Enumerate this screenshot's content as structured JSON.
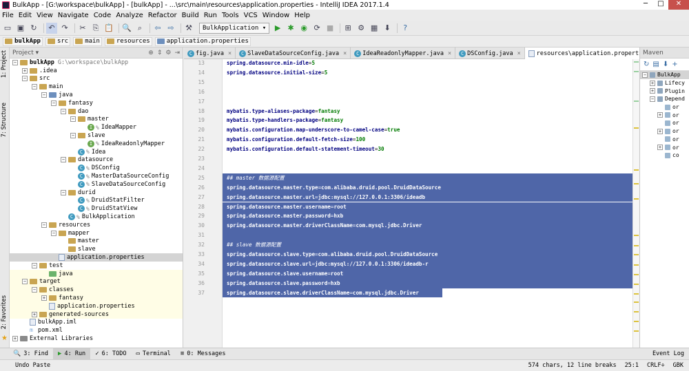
{
  "window": {
    "title": "BulkApp - [G:\\workspace\\bulkApp] - [bulkApp] - ...\\src\\main\\resources\\application.properties - IntelliJ IDEA 2017.1.4"
  },
  "menu": [
    "File",
    "Edit",
    "View",
    "Navigate",
    "Code",
    "Analyze",
    "Refactor",
    "Build",
    "Run",
    "Tools",
    "VCS",
    "Window",
    "Help"
  ],
  "toolbar": {
    "run_config": "BulkApplication ▾"
  },
  "breadcrumbs": [
    "bulkApp",
    "src",
    "main",
    "resources",
    "application.properties"
  ],
  "left_strip": {
    "project": "1: Project",
    "structure": "7: Structure",
    "favorites": "2: Favorites"
  },
  "project_panel": {
    "header": "Project ▾",
    "tree": [
      {
        "d": 0,
        "exp": "−",
        "icon": "folder",
        "label": "bulkApp",
        "path": "G:\\workspace\\bulkApp",
        "bold": true
      },
      {
        "d": 1,
        "exp": "+",
        "icon": "folder",
        "label": ".idea"
      },
      {
        "d": 1,
        "exp": "−",
        "icon": "folder",
        "label": "src"
      },
      {
        "d": 2,
        "exp": "−",
        "icon": "folder",
        "label": "main"
      },
      {
        "d": 3,
        "exp": "−",
        "icon": "folder-blue",
        "label": "java"
      },
      {
        "d": 4,
        "exp": "−",
        "icon": "folder",
        "label": "fantasy"
      },
      {
        "d": 5,
        "exp": "−",
        "icon": "folder",
        "label": "dao"
      },
      {
        "d": 6,
        "exp": "−",
        "icon": "folder",
        "label": "master"
      },
      {
        "d": 7,
        "exp": "",
        "icon": "interface",
        "label": "IdeaMapper"
      },
      {
        "d": 6,
        "exp": "−",
        "icon": "folder",
        "label": "slave"
      },
      {
        "d": 7,
        "exp": "",
        "icon": "interface",
        "label": "IdeaReadonlyMapper"
      },
      {
        "d": 6,
        "exp": "",
        "icon": "class",
        "label": "Idea"
      },
      {
        "d": 5,
        "exp": "−",
        "icon": "folder",
        "label": "datasource"
      },
      {
        "d": 6,
        "exp": "",
        "icon": "class",
        "label": "DSConfig"
      },
      {
        "d": 6,
        "exp": "",
        "icon": "class",
        "label": "MasterDataSourceConfig"
      },
      {
        "d": 6,
        "exp": "",
        "icon": "class",
        "label": "SlaveDataSourceConfig"
      },
      {
        "d": 5,
        "exp": "−",
        "icon": "folder",
        "label": "durid"
      },
      {
        "d": 6,
        "exp": "",
        "icon": "class",
        "label": "DruidStatFilter"
      },
      {
        "d": 6,
        "exp": "",
        "icon": "class",
        "label": "DruidStatView"
      },
      {
        "d": 5,
        "exp": "",
        "icon": "class",
        "label": "BulkApplication"
      },
      {
        "d": 3,
        "exp": "−",
        "icon": "folder",
        "label": "resources"
      },
      {
        "d": 4,
        "exp": "−",
        "icon": "folder",
        "label": "mapper"
      },
      {
        "d": 5,
        "exp": "",
        "icon": "folder",
        "label": "master"
      },
      {
        "d": 5,
        "exp": "",
        "icon": "folder",
        "label": "slave"
      },
      {
        "d": 4,
        "exp": "",
        "icon": "file",
        "label": "application.properties",
        "sel": true
      },
      {
        "d": 2,
        "exp": "−",
        "icon": "folder",
        "label": "test"
      },
      {
        "d": 3,
        "exp": "",
        "icon": "folder-green",
        "label": "java",
        "yel": true
      },
      {
        "d": 1,
        "exp": "−",
        "icon": "folder",
        "label": "target",
        "yel": true
      },
      {
        "d": 2,
        "exp": "−",
        "icon": "folder",
        "label": "classes",
        "yel": true
      },
      {
        "d": 3,
        "exp": "+",
        "icon": "folder",
        "label": "fantasy",
        "yel": true
      },
      {
        "d": 3,
        "exp": "",
        "icon": "file",
        "label": "application.properties",
        "yel": true
      },
      {
        "d": 2,
        "exp": "+",
        "icon": "folder",
        "label": "generated-sources",
        "yel": true
      },
      {
        "d": 1,
        "exp": "",
        "icon": "file",
        "label": "bulkApp.iml"
      },
      {
        "d": 1,
        "exp": "",
        "icon": "maven",
        "label": "pom.xml"
      },
      {
        "d": 0,
        "exp": "+",
        "icon": "lib",
        "label": "External Libraries"
      }
    ]
  },
  "tabs": [
    {
      "label": "fig.java",
      "x": true
    },
    {
      "label": "SlaveDataSourceConfig.java",
      "x": true
    },
    {
      "label": "IdeaReadonlyMapper.java",
      "x": true
    },
    {
      "label": "DSConfig.java",
      "x": true
    },
    {
      "label": "resources\\application.properties",
      "x": true,
      "active": true
    }
  ],
  "editor": {
    "lines": [
      {
        "n": "13",
        "k": "spring.datasource.min-idle",
        "v": "5"
      },
      {
        "n": "14",
        "k": "spring.datasource.initial-size",
        "v": "5"
      },
      {
        "n": "15",
        "k": "",
        "v": ""
      },
      {
        "n": "16",
        "k": "",
        "v": ""
      },
      {
        "n": "17",
        "k": "",
        "v": ""
      },
      {
        "n": "18",
        "k": "mybatis.type-aliases-package",
        "v": "fantasy"
      },
      {
        "n": "19",
        "k": "mybatis.type-handlers-package",
        "v": "fantasy"
      },
      {
        "n": "20",
        "k": "mybatis.configuration.map-underscore-to-camel-case",
        "v": "true"
      },
      {
        "n": "21",
        "k": "mybatis.configuration.default-fetch-size",
        "v": "100"
      },
      {
        "n": "22",
        "k": "mybatis.configuration.default-statement-timeout",
        "v": "30"
      },
      {
        "n": "23",
        "k": "",
        "v": ""
      },
      {
        "n": "24",
        "k": "",
        "v": ""
      },
      {
        "n": "25",
        "c": "## master 数据源配置",
        "sel": true
      },
      {
        "n": "26",
        "k": "spring.datasource.master.type",
        "v": "com.alibaba.druid.pool.DruidDataSource",
        "sel": true
      },
      {
        "n": "27",
        "k": "spring.datasource.master.url",
        "v": "jdbc:mysql://127.0.0.1:3306/ideadb",
        "sel": true
      },
      {
        "n": "28",
        "k": "spring.datasource.master.username",
        "v": "root",
        "sel": true
      },
      {
        "n": "29",
        "k": "spring.datasource.master.password",
        "v": "hxb",
        "sel": true
      },
      {
        "n": "30",
        "k": "spring.datasource.master.driverClassName",
        "v": "com.mysql.jdbc.Driver",
        "sel": true
      },
      {
        "n": "31",
        "k": "",
        "v": "",
        "sel": true
      },
      {
        "n": "32",
        "c": "## slave 数据源配置",
        "sel": true
      },
      {
        "n": "33",
        "k": "spring.datasource.slave.type",
        "v": "com.alibaba.druid.pool.DruidDataSource",
        "sel": true
      },
      {
        "n": "34",
        "k": "spring.datasource.slave.url",
        "v": "jdbc:mysql://127.0.0.1:3306/ideadb-r",
        "sel": true
      },
      {
        "n": "35",
        "k": "spring.datasource.slave.username",
        "v": "root",
        "sel": true
      },
      {
        "n": "36",
        "k": "spring.datasource.slave.password",
        "v": "hxb",
        "sel": true
      },
      {
        "n": "37",
        "k": "spring.datasource.slave.driverClassName",
        "v": "com.mysql.jdbc.Driver",
        "sel": true,
        "partial": true
      }
    ]
  },
  "maven": {
    "header": "Maven",
    "tree": [
      {
        "d": 0,
        "exp": "−",
        "label": "BulkApp",
        "sel": true
      },
      {
        "d": 1,
        "exp": "+",
        "label": "Lifecy"
      },
      {
        "d": 1,
        "exp": "+",
        "label": "Plugin"
      },
      {
        "d": 1,
        "exp": "−",
        "label": "Depend"
      },
      {
        "d": 2,
        "exp": "",
        "label": "or"
      },
      {
        "d": 2,
        "exp": "+",
        "label": "or"
      },
      {
        "d": 2,
        "exp": "",
        "label": "or"
      },
      {
        "d": 2,
        "exp": "+",
        "label": "or"
      },
      {
        "d": 2,
        "exp": "",
        "label": "or"
      },
      {
        "d": 2,
        "exp": "+",
        "label": "or"
      },
      {
        "d": 2,
        "exp": "",
        "label": "co"
      }
    ]
  },
  "bottom_tabs": [
    {
      "icon": "🔍",
      "label": "3: Find"
    },
    {
      "icon": "▶",
      "label": "4: Run",
      "active": true
    },
    {
      "icon": "✓",
      "label": "6: TODO"
    },
    {
      "icon": "▭",
      "label": "Terminal"
    },
    {
      "icon": "≡",
      "label": "0: Messages"
    }
  ],
  "event_log": "Event Log",
  "status": {
    "message": "Undo Paste",
    "chars": "574 chars, 12 line breaks",
    "pos": "25:1",
    "crlf": "CRLF÷",
    "enc": "GBK"
  }
}
